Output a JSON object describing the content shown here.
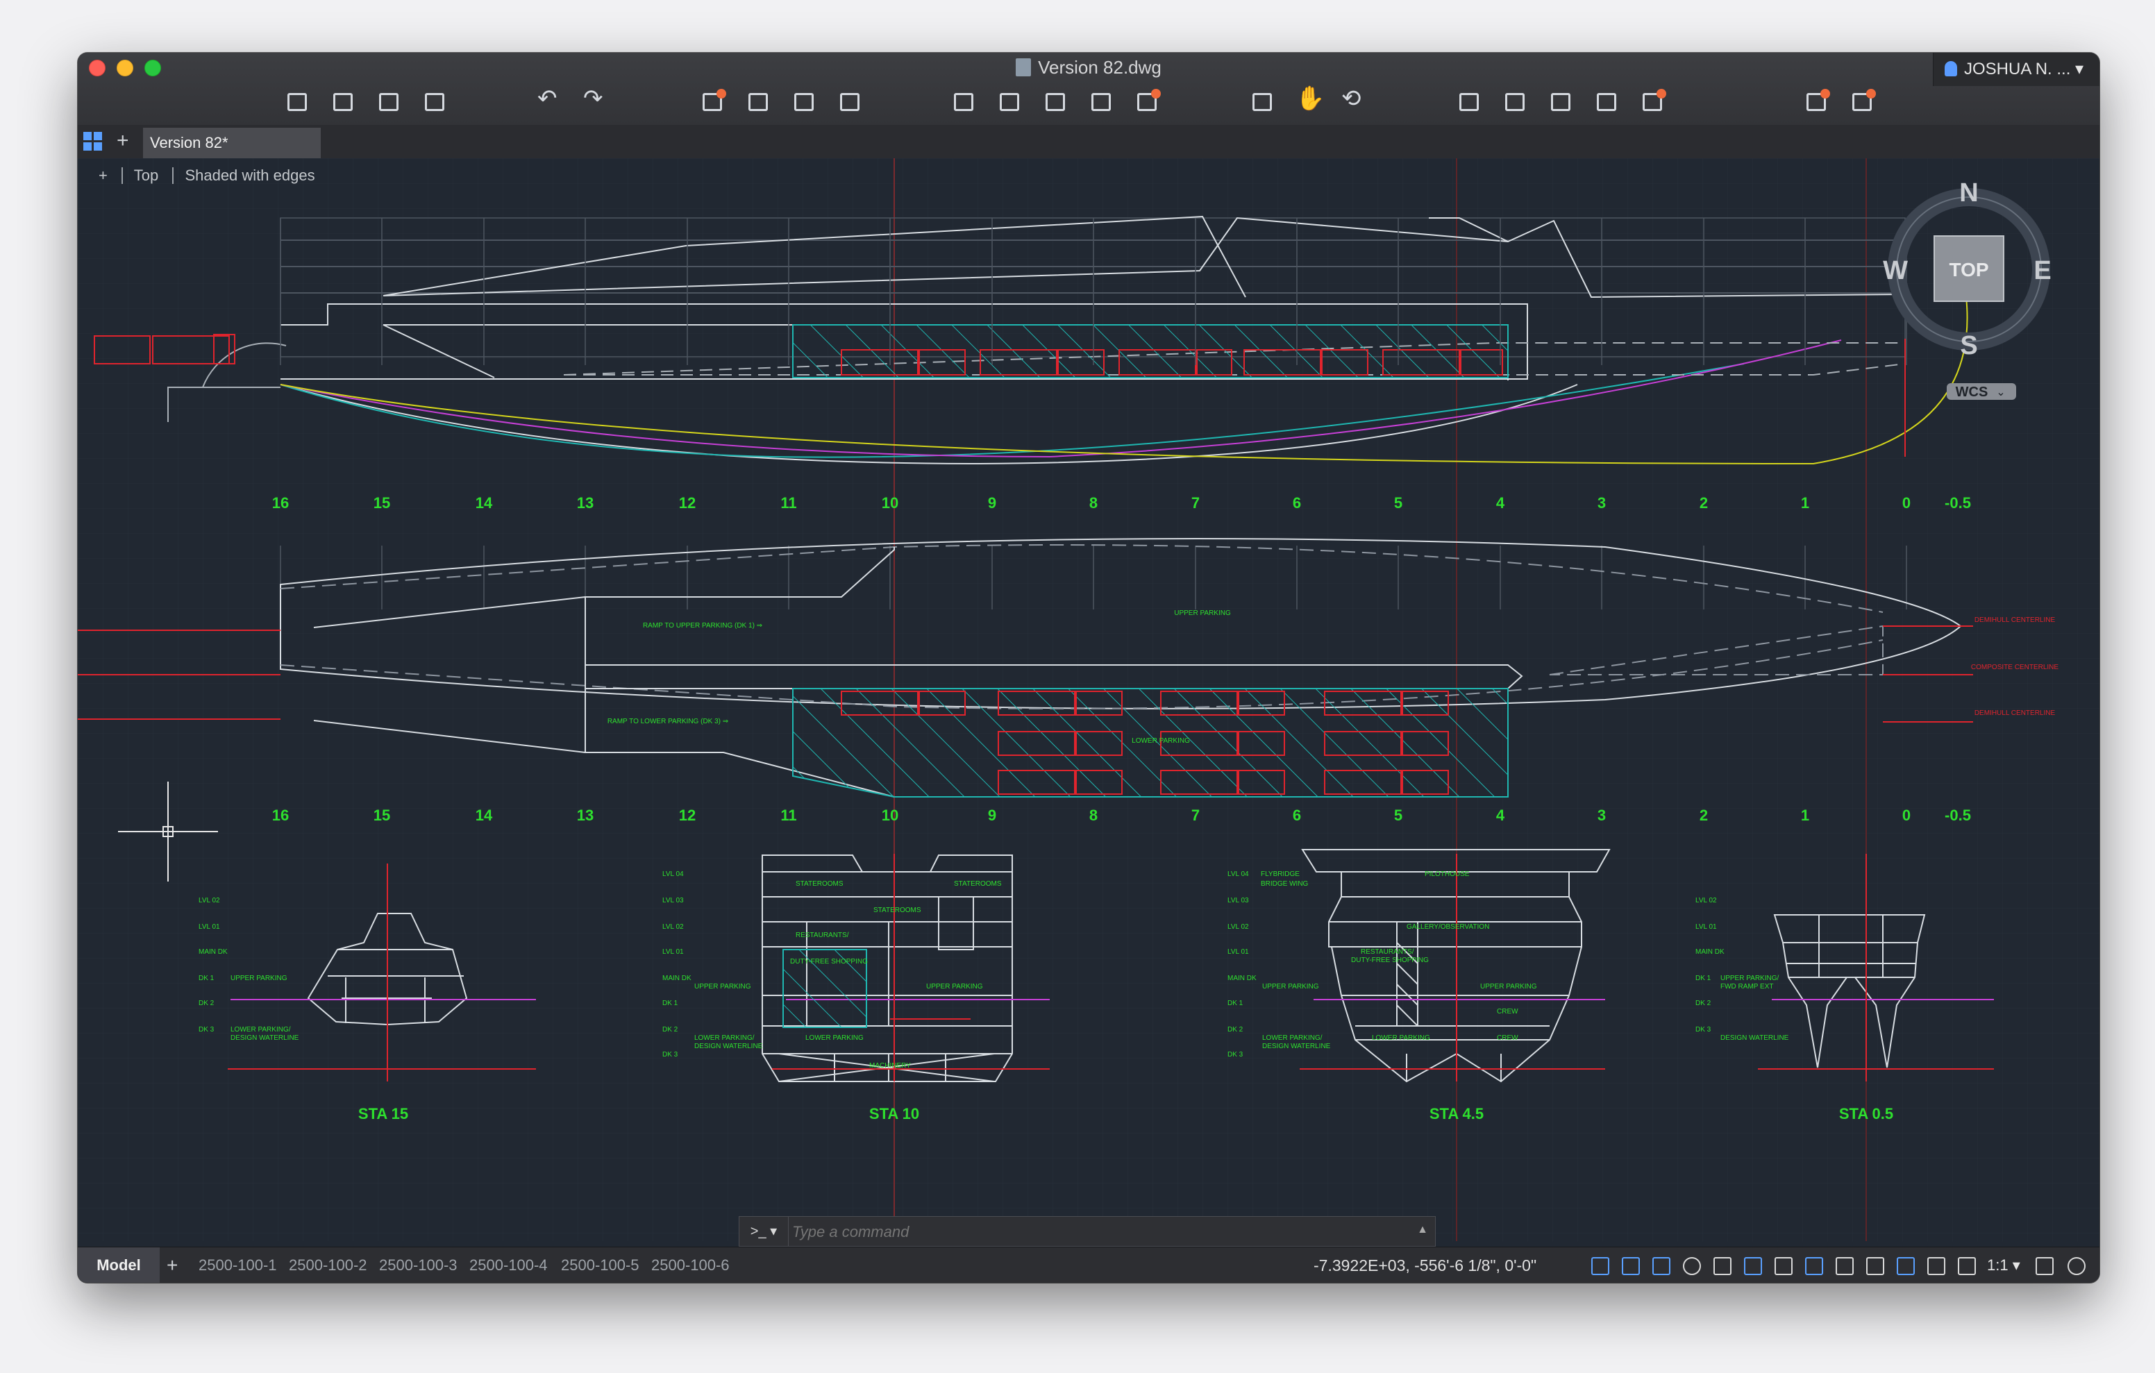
{
  "window": {
    "title": "Version 82.dwg"
  },
  "user": {
    "name": "JOSHUA N. ..."
  },
  "tabs": {
    "active": "Version 82*"
  },
  "viewport": {
    "view": "Top",
    "style": "Shaded with edges",
    "plus": "+"
  },
  "viewcube": {
    "n": "N",
    "s": "S",
    "e": "E",
    "w": "W",
    "face": "TOP",
    "wcs": "WCS"
  },
  "stations": [
    "16",
    "15",
    "14",
    "13",
    "12",
    "11",
    "10",
    "9",
    "8",
    "7",
    "6",
    "5",
    "4",
    "3",
    "2",
    "1",
    "0",
    "-0.5"
  ],
  "plan_labels": {
    "ramp_upper": "RAMP TO UPPER PARKING (DK 1) ⇒",
    "ramp_lower": "RAMP TO LOWER PARKING (DK 3) ⇒",
    "upper_parking": "UPPER PARKING",
    "lower_parking": "LOWER PARKING",
    "demihull_cl_1": "DEMIHULL CENTERLINE",
    "composite_cl": "COMPOSITE CENTERLINE",
    "demihull_cl_2": "DEMIHULL CENTERLINE"
  },
  "sections": {
    "sta15": {
      "title": "STA 15",
      "levels": [
        "LVL 02",
        "LVL 01",
        "MAIN DK",
        "DK 1",
        "DK 2",
        "DK 3"
      ],
      "notes": [
        "UPPER PARKING",
        "LOWER PARKING/",
        "DESIGN WATERLINE"
      ]
    },
    "sta10": {
      "title": "STA 10",
      "levels": [
        "LVL 04",
        "LVL 03",
        "LVL 02",
        "LVL 01",
        "MAIN DK",
        "DK 1",
        "DK 2",
        "DK 3"
      ],
      "notes": [
        "STATEROOMS",
        "STATEROOMS",
        "STATEROOMS",
        "RESTAURANTS/",
        "DUTY-FREE SHOPPING",
        "UPPER PARKING",
        "UPPER PARKING",
        "LOWER PARKING",
        "LOWER PARKING/",
        "DESIGN WATERLINE",
        "MACHINERY"
      ]
    },
    "sta45": {
      "title": "STA 4.5",
      "levels": [
        "LVL 04",
        "LVL 03",
        "LVL 02",
        "LVL 01",
        "MAIN DK",
        "DK 1",
        "DK 2",
        "DK 3"
      ],
      "notes": [
        "FLYBRIDGE",
        "BRIDGE WING",
        "PILOTHOUSE",
        "GALLERY/OBSERVATION",
        "RESTAURANTS/",
        "DUTY-FREE SHOPPING",
        "UPPER PARKING",
        "UPPER PARKING",
        "CREW",
        "CREW",
        "LOWER PARKING",
        "LOWER PARKING/",
        "DESIGN WATERLINE"
      ]
    },
    "sta05": {
      "title": "STA 0.5",
      "levels": [
        "LVL 02",
        "LVL 01",
        "MAIN DK",
        "DK 1",
        "DK 2",
        "DK 3"
      ],
      "notes": [
        "UPPER PARKING/",
        "FWD RAMP EXT",
        "DESIGN WATERLINE"
      ]
    }
  },
  "command": {
    "prompt": ">_ ▾",
    "placeholder": "Type a command"
  },
  "layouts": {
    "model": "Model",
    "add": "+",
    "items": [
      "2500-100-1",
      "2500-100-2",
      "2500-100-3",
      "2500-100-4",
      "2500-100-5",
      "2500-100-6"
    ]
  },
  "status": {
    "coords": "-7.3922E+03,  -556'-6 1/8\", 0'-0\"",
    "scale": "1:1 ▾"
  },
  "colors": {
    "background": "#212832",
    "grid": "#2c3440",
    "hull": "#d8dde2",
    "station_label": "#2ee02e",
    "red": "#e0242d",
    "cyan": "#1fb7b1",
    "magenta": "#c640d6",
    "yellow": "#d4d51c",
    "accent": "#5aa0ff"
  }
}
